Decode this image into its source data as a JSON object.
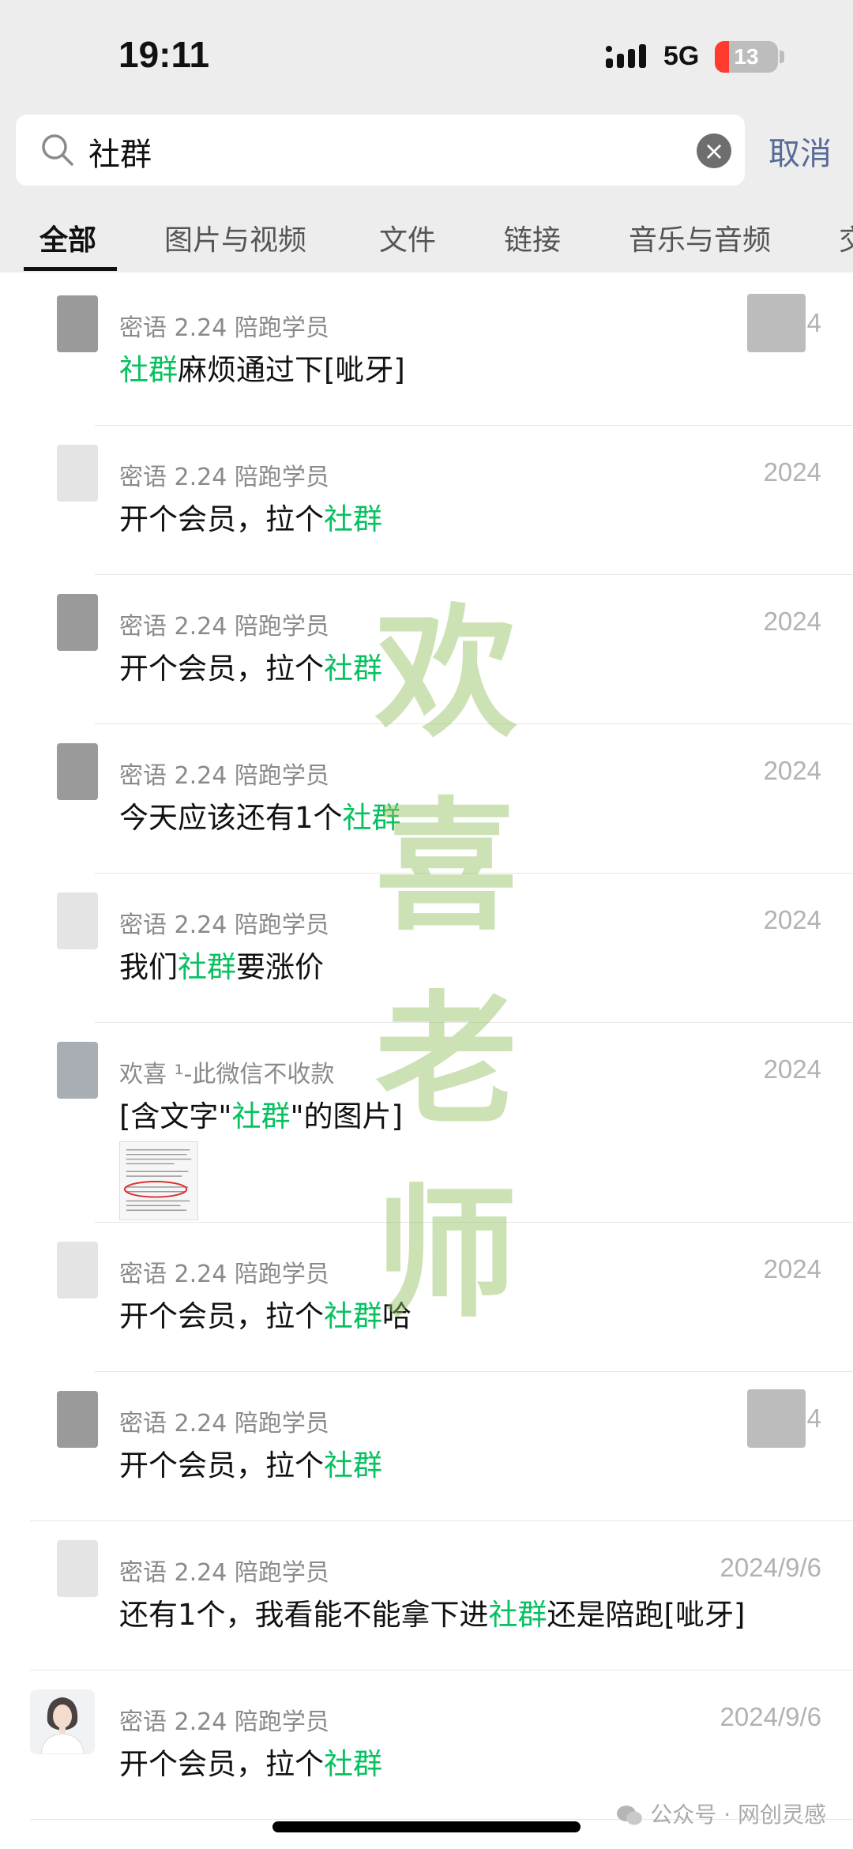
{
  "status_bar": {
    "time": "19:11",
    "network": "5G",
    "battery": "13",
    "battery_level_percent": 13
  },
  "search": {
    "query": "社群",
    "cancel_label": "取消"
  },
  "tabs": [
    {
      "label": "全部",
      "active": true
    },
    {
      "label": "图片与视频",
      "active": false
    },
    {
      "label": "文件",
      "active": false
    },
    {
      "label": "链接",
      "active": false
    },
    {
      "label": "音乐与音频",
      "active": false
    },
    {
      "label": "交",
      "active": false
    }
  ],
  "results": [
    {
      "sender": "密语 2.24 陪跑学员",
      "date": "2024",
      "before": "",
      "keyword": "社群",
      "after": "麻烦通过下[呲牙]"
    },
    {
      "sender": "密语 2.24 陪跑学员",
      "date": "2024",
      "before": "开个会员，拉个",
      "keyword": "社群",
      "after": ""
    },
    {
      "sender": "密语 2.24 陪跑学员",
      "date": "2024",
      "before": "开个会员，拉个",
      "keyword": "社群",
      "after": ""
    },
    {
      "sender": "密语 2.24 陪跑学员",
      "date": "2024",
      "before": "今天应该还有1个",
      "keyword": "社群",
      "after": ""
    },
    {
      "sender": "密语 2.24 陪跑学员",
      "date": "2024",
      "before": "我们",
      "keyword": "社群",
      "after": "要涨价"
    },
    {
      "sender": "欢喜 ¹-此微信不收款",
      "date": "2024",
      "before": "[含文字\"",
      "keyword": "社群",
      "after": "\"的图片]"
    },
    {
      "sender": "密语 2.24 陪跑学员",
      "date": "2024",
      "before": "开个会员，拉个",
      "keyword": "社群",
      "after": "哈"
    },
    {
      "sender": "密语 2.24 陪跑学员",
      "date": "2024",
      "before": "开个会员，拉个",
      "keyword": "社群",
      "after": ""
    },
    {
      "sender": "密语 2.24 陪跑学员",
      "date": "2024/9/6",
      "before": "还有1个，我看能不能拿下进",
      "keyword": "社群",
      "after": "还是陪跑[呲牙]"
    },
    {
      "sender": "密语 2.24 陪跑学员",
      "date": "2024/9/6",
      "before": "开个会员，拉个",
      "keyword": "社群",
      "after": ""
    }
  ],
  "watermark": [
    "欢",
    "喜",
    "老",
    "师"
  ],
  "footer": {
    "brand": "公众号 · 网创灵感"
  },
  "colors": {
    "keyword": "#07c160",
    "cancel": "#576b95",
    "header_bg": "#ededed"
  }
}
